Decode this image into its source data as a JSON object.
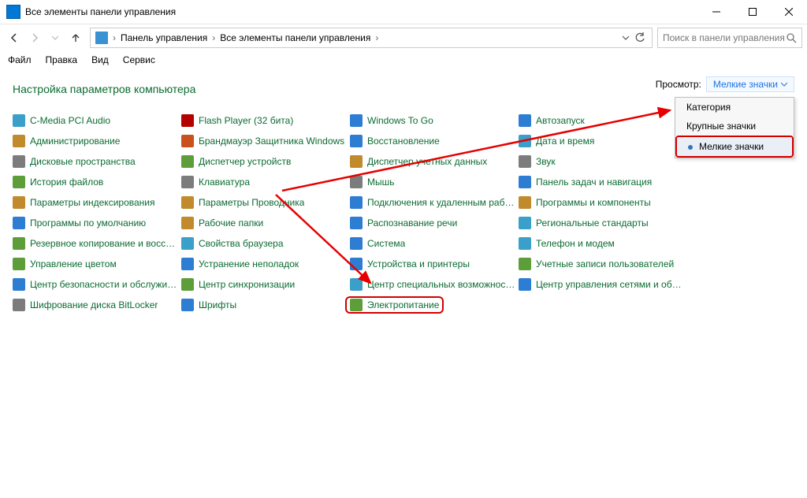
{
  "window": {
    "title": "Все элементы панели управления"
  },
  "breadcrumb": {
    "root": "Панель управления",
    "current": "Все элементы панели управления"
  },
  "search": {
    "placeholder": "Поиск в панели управления"
  },
  "menubar": {
    "file": "Файл",
    "edit": "Правка",
    "view": "Вид",
    "service": "Сервис"
  },
  "heading": "Настройка параметров компьютера",
  "viewrow": {
    "label": "Просмотр:",
    "value": "Мелкие значки"
  },
  "dropdown": {
    "cat": "Категория",
    "large": "Крупные значки",
    "small": "Мелкие значки"
  },
  "items": {
    "c1": "C-Media PCI Audio",
    "c2": "Flash Player (32 бита)",
    "c3": "Windows To Go",
    "c4": "Автозапуск",
    "c5": "Администрирование",
    "c6": "Брандмауэр Защитника Windows",
    "c7": "Восстановление",
    "c8": "Дата и время",
    "c9": "Дисковые пространства",
    "c10": "Диспетчер устройств",
    "c11": "Диспетчер учетных данных",
    "c12": "Звук",
    "c13": "История файлов",
    "c14": "Клавиатура",
    "c15": "Мышь",
    "c16": "Панель задач и навигация",
    "c17": "Параметры индексирования",
    "c18": "Параметры Проводника",
    "c19": "Подключения к удаленным рабоч...",
    "c20": "Программы и компоненты",
    "c21": "Программы по умолчанию",
    "c22": "Рабочие папки",
    "c23": "Распознавание речи",
    "c24": "Региональные стандарты",
    "c25": "Резервное копирование и восстан...",
    "c26": "Свойства браузера",
    "c27": "Система",
    "c28": "Телефон и модем",
    "c29": "Управление цветом",
    "c30": "Устранение неполадок",
    "c31": "Устройства и принтеры",
    "c32": "Учетные записи пользователей",
    "c33": "Центр безопасности и обслуживан...",
    "c34": "Центр синхронизации",
    "c35": "Центр специальных возможностей",
    "c36": "Центр управления сетями и общи...",
    "c37": "Шифрование диска BitLocker",
    "c38": "Шрифты",
    "c39": "Электропитание"
  },
  "icon_colors": {
    "c1": "#3aa0c9",
    "c2": "#b50000",
    "c3": "#2d7dd2",
    "c4": "#2d7dd2",
    "c5": "#c08a2d",
    "c6": "#c9521c",
    "c7": "#2d7dd2",
    "c8": "#3aa0c9",
    "c9": "#7c7c7c",
    "c10": "#5e9e3a",
    "c11": "#c08a2d",
    "c12": "#7c7c7c",
    "c13": "#5e9e3a",
    "c14": "#7c7c7c",
    "c15": "#7c7c7c",
    "c16": "#2d7dd2",
    "c17": "#c08a2d",
    "c18": "#c08a2d",
    "c19": "#2d7dd2",
    "c20": "#c08a2d",
    "c21": "#2d7dd2",
    "c22": "#c08a2d",
    "c23": "#2d7dd2",
    "c24": "#3aa0c9",
    "c25": "#5e9e3a",
    "c26": "#3aa0c9",
    "c27": "#2d7dd2",
    "c28": "#3aa0c9",
    "c29": "#5e9e3a",
    "c30": "#2d7dd2",
    "c31": "#2d7dd2",
    "c32": "#5e9e3a",
    "c33": "#2d7dd2",
    "c34": "#5e9e3a",
    "c35": "#3aa0c9",
    "c36": "#2d7dd2",
    "c37": "#7c7c7c",
    "c38": "#2d7dd2",
    "c39": "#5e9e3a"
  }
}
